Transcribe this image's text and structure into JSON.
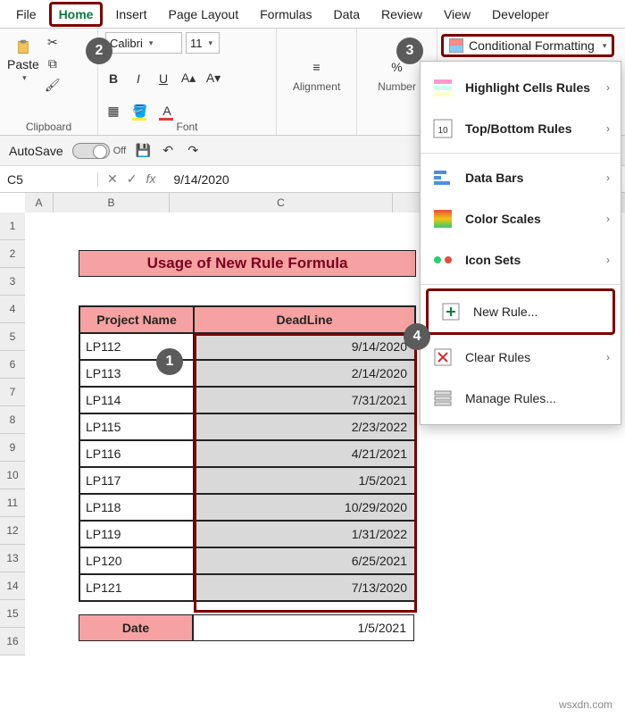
{
  "tabs": [
    "File",
    "Home",
    "Insert",
    "Page Layout",
    "Formulas",
    "Data",
    "Review",
    "View",
    "Developer"
  ],
  "active_tab": "Home",
  "ribbon": {
    "clipboard_label": "Clipboard",
    "paste_label": "Paste",
    "font_label": "Font",
    "font_name": "Calibri",
    "font_size": "11",
    "alignment_label": "Alignment",
    "number_label": "Number",
    "cf_button": "Conditional Formatting"
  },
  "qat": {
    "autosave": "AutoSave",
    "autosave_state": "Off"
  },
  "namebox": "C5",
  "formula": "9/14/2020",
  "columns": [
    "A",
    "B",
    "C"
  ],
  "rows": [
    "1",
    "2",
    "3",
    "4",
    "5",
    "6",
    "7",
    "8",
    "9",
    "10",
    "11",
    "12",
    "13",
    "14",
    "15",
    "16"
  ],
  "banner": "Usage of New Rule Formula",
  "headers": {
    "project": "Project Name",
    "deadline": "DeadLine"
  },
  "data_rows": [
    {
      "project": "LP112",
      "deadline": "9/14/2020"
    },
    {
      "project": "LP113",
      "deadline": "2/14/2020"
    },
    {
      "project": "LP114",
      "deadline": "7/31/2021"
    },
    {
      "project": "LP115",
      "deadline": "2/23/2022"
    },
    {
      "project": "LP116",
      "deadline": "4/21/2021"
    },
    {
      "project": "LP117",
      "deadline": "1/5/2021"
    },
    {
      "project": "LP118",
      "deadline": "10/29/2020"
    },
    {
      "project": "LP119",
      "deadline": "1/31/2022"
    },
    {
      "project": "LP120",
      "deadline": "6/25/2021"
    },
    {
      "project": "LP121",
      "deadline": "7/13/2020"
    }
  ],
  "date_row": {
    "label": "Date",
    "value": "1/5/2021"
  },
  "cf_menu": {
    "highlight": "Highlight Cells Rules",
    "topbottom": "Top/Bottom Rules",
    "databars": "Data Bars",
    "colorscales": "Color Scales",
    "iconsets": "Icon Sets",
    "newrule": "New Rule...",
    "clear": "Clear Rules",
    "manage": "Manage Rules..."
  },
  "badges": {
    "b1": "1",
    "b2": "2",
    "b3": "3",
    "b4": "4"
  },
  "watermark": "wsxdn.com"
}
